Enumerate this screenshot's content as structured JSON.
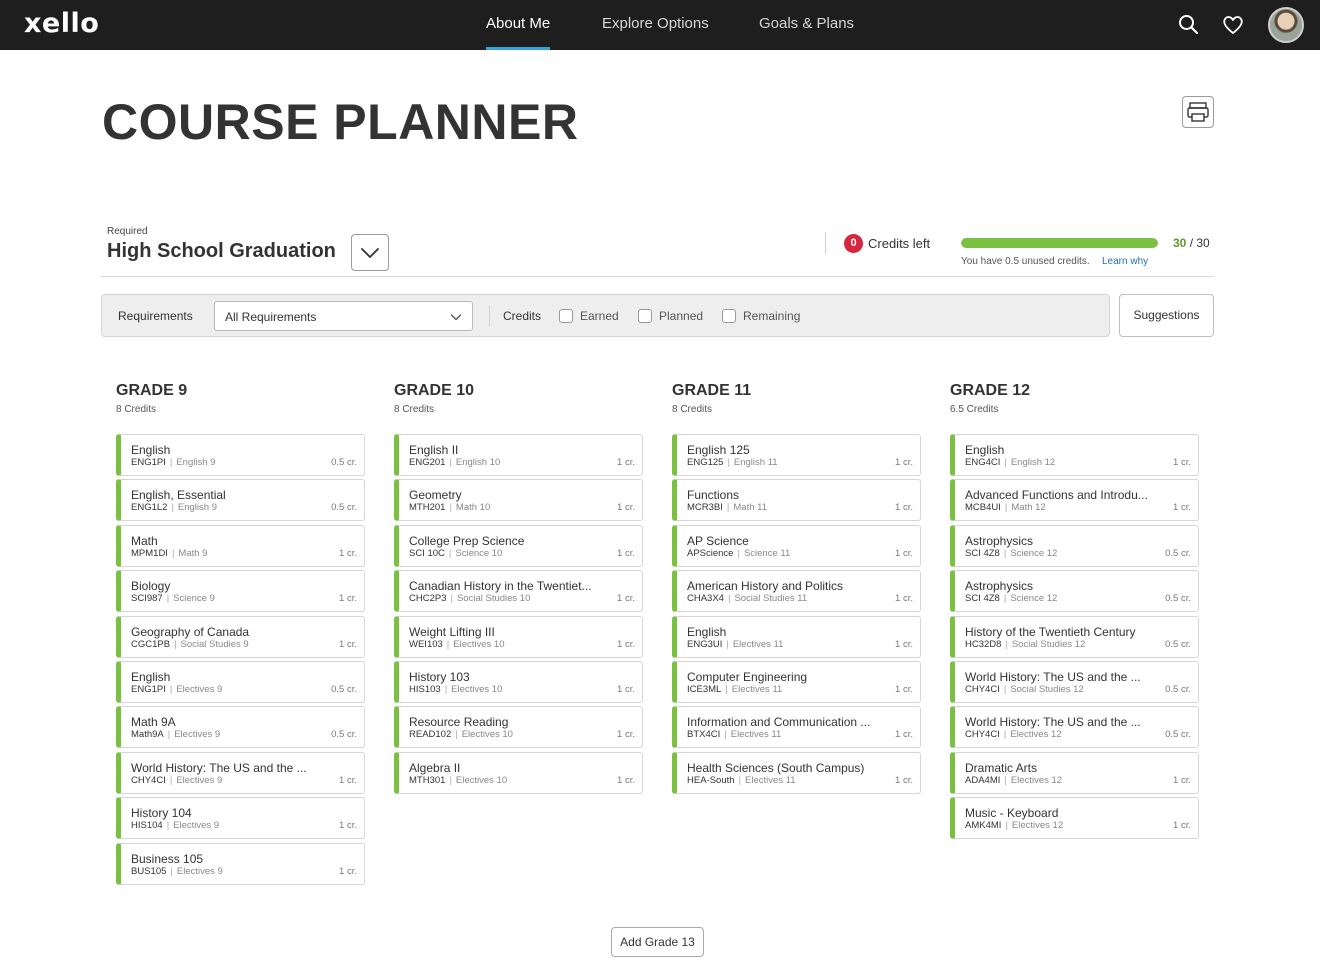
{
  "nav": {
    "logo": "xello",
    "items": [
      {
        "label": "About Me"
      },
      {
        "label": "Explore Options"
      },
      {
        "label": "Goals & Plans"
      }
    ],
    "icons": [
      "search-icon",
      "heart-icon",
      "avatar"
    ]
  },
  "page": {
    "title": "COURSE PLANNER"
  },
  "requirement": {
    "label": "Required",
    "name": "High School Graduation",
    "credits_left_value": "0",
    "credits_left_label": "Credits left",
    "progress": {
      "done": "30",
      "total": "/ 30",
      "fraction": 1.0
    },
    "unused_text": "You have 0.5 unused credits.",
    "learn_link": "Learn why"
  },
  "filters": {
    "requirements_label": "Requirements",
    "requirements_selected": "All Requirements",
    "credits_label": "Credits",
    "checkboxes": [
      {
        "label": "Earned",
        "checked": false
      },
      {
        "label": "Planned",
        "checked": false
      },
      {
        "label": "Remaining",
        "checked": false
      }
    ],
    "suggestions_label": "Suggestions"
  },
  "accent_color": "#7ac142",
  "grades": [
    {
      "title": "GRADE 9",
      "credits": "8 Credits",
      "courses": [
        {
          "name": "English",
          "code": "ENG1PI",
          "category": "English 9",
          "credits": "0.5 cr."
        },
        {
          "name": "English, Essential",
          "code": "ENG1L2",
          "category": "English 9",
          "credits": "0.5 cr."
        },
        {
          "name": "Math",
          "code": "MPM1DI",
          "category": "Math 9",
          "credits": "1 cr."
        },
        {
          "name": "Biology",
          "code": "SCI987",
          "category": "Science 9",
          "credits": "1 cr."
        },
        {
          "name": "Geography of Canada",
          "code": "CGC1PB",
          "category": "Social Studies 9",
          "credits": "1 cr."
        },
        {
          "name": "English",
          "code": "ENG1PI",
          "category": "Electives 9",
          "credits": "0.5 cr."
        },
        {
          "name": "Math 9A",
          "code": "Math9A",
          "category": "Electives 9",
          "credits": "0.5 cr."
        },
        {
          "name": "World History: The US and the ...",
          "code": "CHY4CI",
          "category": "Electives 9",
          "credits": "1 cr."
        },
        {
          "name": "History 104",
          "code": "HIS104",
          "category": "Electives 9",
          "credits": "1 cr."
        },
        {
          "name": "Business 105",
          "code": "BUS105",
          "category": "Electives 9",
          "credits": "1 cr."
        }
      ]
    },
    {
      "title": "GRADE 10",
      "credits": "8 Credits",
      "courses": [
        {
          "name": "English II",
          "code": "ENG201",
          "category": "English 10",
          "credits": "1 cr."
        },
        {
          "name": "Geometry",
          "code": "MTH201",
          "category": "Math 10",
          "credits": "1 cr."
        },
        {
          "name": "College Prep Science",
          "code": "SCI 10C",
          "category": "Science 10",
          "credits": "1 cr."
        },
        {
          "name": "Canadian History in the Twentiet...",
          "code": "CHC2P3",
          "category": "Social Studies 10",
          "credits": "1 cr."
        },
        {
          "name": "Weight Lifting III",
          "code": "WEI103",
          "category": "Electives 10",
          "credits": "1 cr."
        },
        {
          "name": "History 103",
          "code": "HIS103",
          "category": "Electives 10",
          "credits": "1 cr."
        },
        {
          "name": "Resource Reading",
          "code": "READ102",
          "category": "Electives 10",
          "credits": "1 cr."
        },
        {
          "name": "Algebra II",
          "code": "MTH301",
          "category": "Electives 10",
          "credits": "1 cr."
        }
      ]
    },
    {
      "title": "GRADE 11",
      "credits": "8 Credits",
      "courses": [
        {
          "name": "English 125",
          "code": "ENG125",
          "category": "English 11",
          "credits": "1 cr."
        },
        {
          "name": "Functions",
          "code": "MCR3BI",
          "category": "Math 11",
          "credits": "1 cr."
        },
        {
          "name": "AP Science",
          "code": "APScience",
          "category": "Science 11",
          "credits": "1 cr."
        },
        {
          "name": "American History and Politics",
          "code": "CHA3X4",
          "category": "Social Studies 11",
          "credits": "1 cr."
        },
        {
          "name": "English",
          "code": "ENG3UI",
          "category": "Electives 11",
          "credits": "1 cr."
        },
        {
          "name": "Computer Engineering",
          "code": "ICE3ML",
          "category": "Electives 11",
          "credits": "1 cr."
        },
        {
          "name": "Information and Communication ...",
          "code": "BTX4CI",
          "category": "Electives 11",
          "credits": "1 cr."
        },
        {
          "name": "Health Sciences (South Campus)",
          "code": "HEA-South",
          "category": "Electives 11",
          "credits": "1 cr."
        }
      ]
    },
    {
      "title": "GRADE 12",
      "credits": "6.5 Credits",
      "courses": [
        {
          "name": "English",
          "code": "ENG4CI",
          "category": "English 12",
          "credits": "1 cr."
        },
        {
          "name": "Advanced Functions and Introdu...",
          "code": "MCB4UI",
          "category": "Math 12",
          "credits": "1 cr."
        },
        {
          "name": "Astrophysics",
          "code": "SCI 4Z8",
          "category": "Science 12",
          "credits": "0.5 cr."
        },
        {
          "name": "Astrophysics",
          "code": "SCI 4Z8",
          "category": "Science 12",
          "credits": "0.5 cr."
        },
        {
          "name": "History of the Twentieth Century",
          "code": "HC32D8",
          "category": "Social Studies 12",
          "credits": "0.5 cr."
        },
        {
          "name": "World History: The US and the ...",
          "code": "CHY4CI",
          "category": "Social Studies 12",
          "credits": "0.5 cr."
        },
        {
          "name": "World History: The US and the ...",
          "code": "CHY4CI",
          "category": "Electives 12",
          "credits": "0.5 cr."
        },
        {
          "name": "Dramatic Arts",
          "code": "ADA4MI",
          "category": "Electives 12",
          "credits": "1 cr."
        },
        {
          "name": "Music - Keyboard",
          "code": "AMK4MI",
          "category": "Electives 12",
          "credits": "1 cr."
        }
      ]
    }
  ],
  "add_grade_label": "Add Grade 13"
}
